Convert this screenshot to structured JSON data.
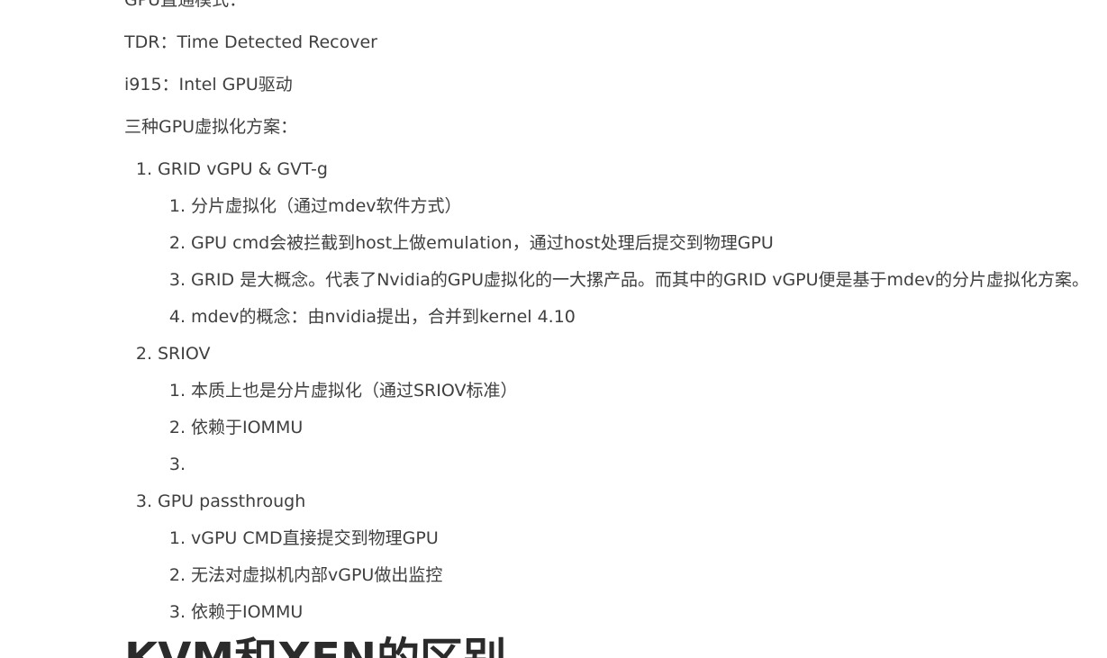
{
  "paragraphs": [
    "GPU直通模式：",
    "TDR：Time Detected Recover",
    "i915：Intel GPU驱动",
    "三种GPU虚拟化方案："
  ],
  "list": [
    {
      "num": "1.",
      "label": "GRID vGPU  & GVT-g",
      "items": [
        {
          "num": "1.",
          "text": "分片虚拟化（通过mdev软件方式）"
        },
        {
          "num": "2.",
          "text": "GPU cmd会被拦截到host上做emulation，通过host处理后提交到物理GPU"
        },
        {
          "num": "3.",
          "text": "GRID 是大概念。代表了Nvidia的GPU虚拟化的一大摞产品。而其中的GRID vGPU便是基于mdev的分片虚拟化方案。"
        },
        {
          "num": "4.",
          "text": "mdev的概念：由nvidia提出，合并到kernel 4.10"
        }
      ]
    },
    {
      "num": "2.",
      "label": "SRIOV",
      "items": [
        {
          "num": "1.",
          "text": "本质上也是分片虚拟化（通过SRIOV标准）"
        },
        {
          "num": "2.",
          "text": "依赖于IOMMU"
        },
        {
          "num": "3.",
          "text": ""
        }
      ]
    },
    {
      "num": "3.",
      "label": "GPU passthrough",
      "items": [
        {
          "num": "1.",
          "text": "vGPU CMD直接提交到物理GPU"
        },
        {
          "num": "2.",
          "text": "无法对虚拟机内部vGPU做出监控"
        },
        {
          "num": "3.",
          "text": "依赖于IOMMU"
        }
      ]
    }
  ],
  "next_heading": "KVM和XEN的区别"
}
